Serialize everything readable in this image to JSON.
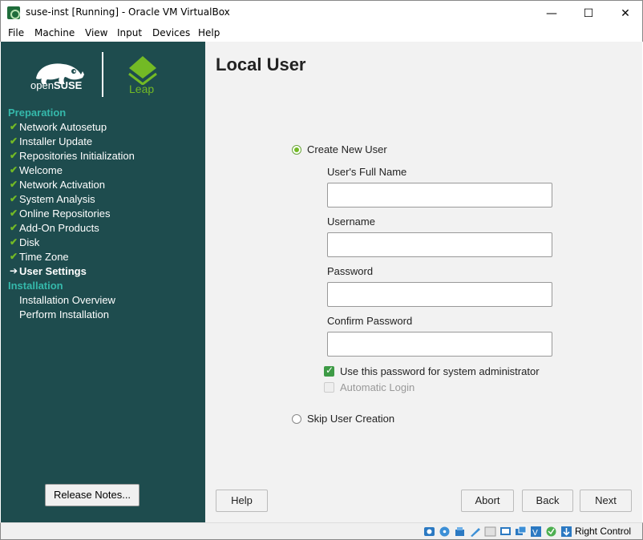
{
  "window": {
    "title": "suse-inst [Running] - Oracle VM VirtualBox",
    "minimize_glyph": "—",
    "maximize_glyph": "☐",
    "close_glyph": "✕"
  },
  "menu": [
    "File",
    "Machine",
    "View",
    "Input",
    "Devices",
    "Help"
  ],
  "sidebar": {
    "brand_open": "open",
    "brand_suse": "SUSE",
    "leap_label": "Leap",
    "sections": [
      {
        "title": "Preparation",
        "steps": [
          {
            "label": "Network Autosetup",
            "state": "done"
          },
          {
            "label": "Installer Update",
            "state": "done"
          },
          {
            "label": "Repositories Initialization",
            "state": "done"
          },
          {
            "label": "Welcome",
            "state": "done"
          },
          {
            "label": "Network Activation",
            "state": "done"
          },
          {
            "label": "System Analysis",
            "state": "done"
          },
          {
            "label": "Online Repositories",
            "state": "done"
          },
          {
            "label": "Add-On Products",
            "state": "done"
          },
          {
            "label": "Disk",
            "state": "done"
          },
          {
            "label": "Time Zone",
            "state": "done"
          },
          {
            "label": "User Settings",
            "state": "current"
          }
        ]
      },
      {
        "title": "Installation",
        "steps": [
          {
            "label": "Installation Overview",
            "state": "pending"
          },
          {
            "label": "Perform Installation",
            "state": "pending"
          }
        ]
      }
    ],
    "release_notes_label": "Release Notes..."
  },
  "page": {
    "title": "Local User",
    "create_user_label": "Create New User",
    "create_user_selected": true,
    "fields": [
      {
        "label": "User's Full Name",
        "value": ""
      },
      {
        "label": "Username",
        "value": ""
      },
      {
        "label": "Password",
        "value": ""
      },
      {
        "label": "Confirm Password",
        "value": ""
      }
    ],
    "use_for_admin_label": "Use this password for system administrator",
    "use_for_admin_checked": true,
    "auto_login_label": "Automatic Login",
    "auto_login_checked": false,
    "auto_login_enabled": false,
    "skip_user_label": "Skip User Creation",
    "skip_user_selected": false
  },
  "buttons": {
    "help": "Help",
    "abort": "Abort",
    "back": "Back",
    "next": "Next"
  },
  "statusbar": {
    "host_key": "Right Control",
    "icons": [
      "hard-disk-icon",
      "optical-drive-icon",
      "audio-icon",
      "network-icon",
      "usb-icon",
      "shared-folders-icon",
      "display-icon",
      "video-capture-icon",
      "recording-icon",
      "cpu-icon",
      "mouse-integration-icon",
      "keyboard-icon"
    ]
  },
  "colors": {
    "sidebar_bg": "#1e4c4e",
    "section_title": "#35b9ab",
    "accent_green": "#73ba25",
    "content_bg": "#f2f2f2"
  }
}
